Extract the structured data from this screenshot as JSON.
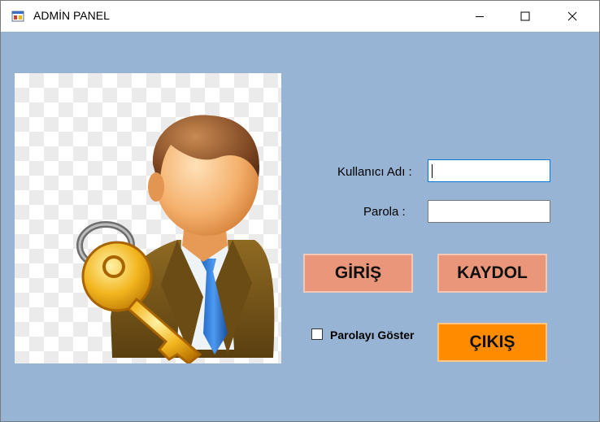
{
  "window": {
    "title": "ADMİN PANEL",
    "icon": "app-window-icon",
    "controls": [
      "minimize-icon",
      "maximize-icon",
      "close-icon"
    ]
  },
  "colors": {
    "client_bg": "#98b4d4",
    "button_pink": "#e9967a",
    "button_orange": "#ff8c00"
  },
  "image": {
    "icon": "admin-user-key-icon"
  },
  "form": {
    "username_label": "Kullanıcı Adı :",
    "username_value": "",
    "password_label": "Parola :",
    "password_value": ""
  },
  "buttons": {
    "login": "GİRİŞ",
    "register": "KAYDOL",
    "exit": "ÇIKIŞ"
  },
  "show_password": {
    "label": "Parolayı Göster",
    "checked": false
  }
}
